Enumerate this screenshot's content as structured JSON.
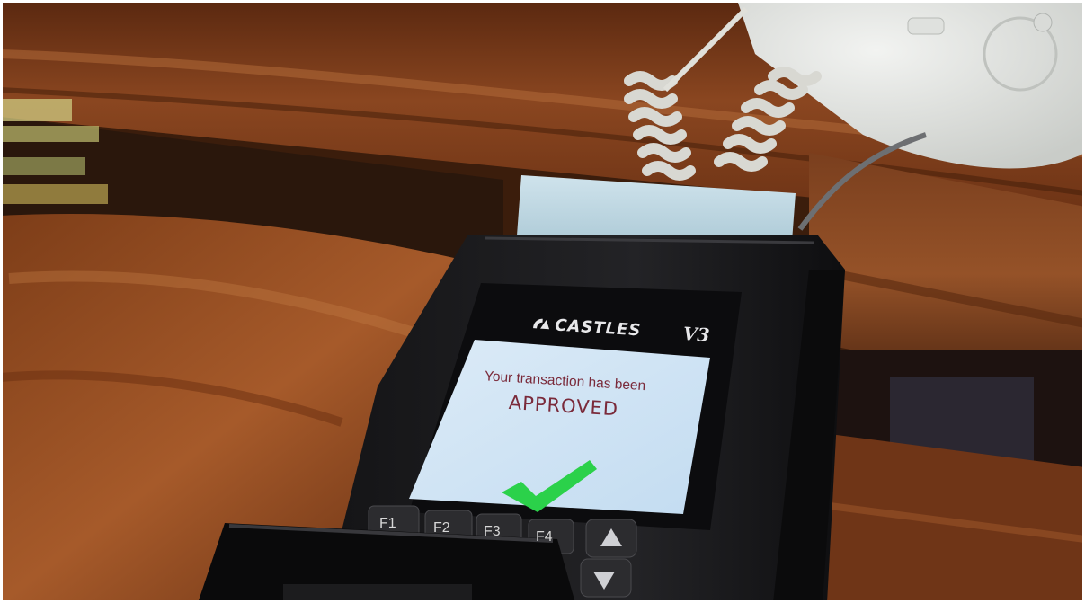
{
  "terminal": {
    "brand": "CASTLES",
    "model": "V3",
    "screen": {
      "line1": "Your transaction has been",
      "status": "APPROVED"
    },
    "function_keys": [
      "F1",
      "F2",
      "F3",
      "F4"
    ]
  },
  "colors": {
    "screen_background": "#cfe3f4",
    "message_text": "#7a2a3a",
    "checkmark": "#2bd14a",
    "wood": "#7a3b1c",
    "terminal_body": "#1b1b1d"
  },
  "icons": {
    "checkmark": "checkmark-icon",
    "nav_up": "arrow-up-icon",
    "nav_down": "arrow-down-icon",
    "brand_logo": "castles-logo-icon"
  }
}
